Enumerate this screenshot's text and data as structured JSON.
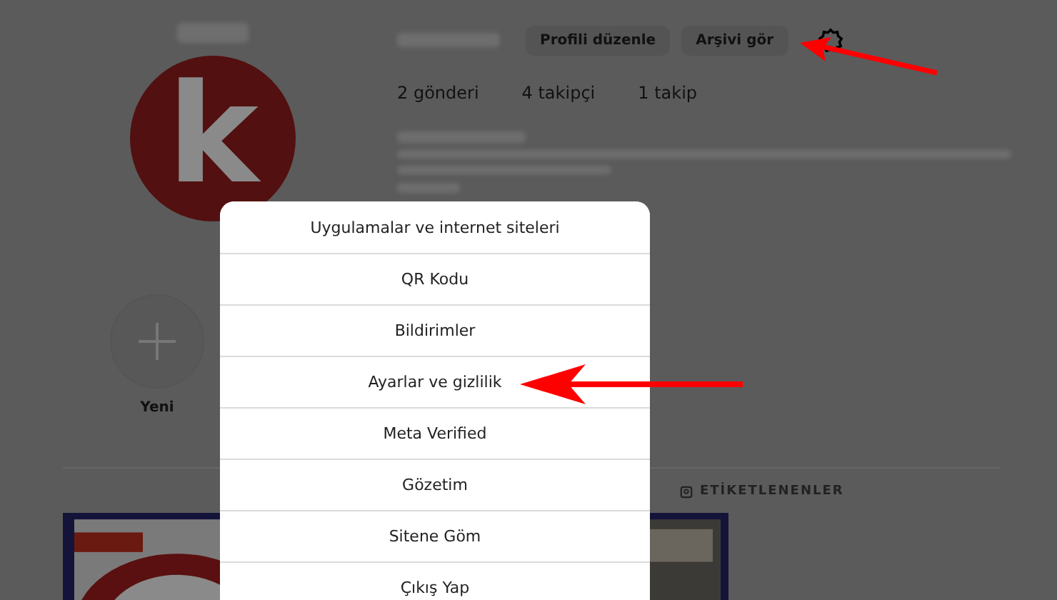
{
  "profile": {
    "avatar_letter": "k",
    "buttons": [
      "Profili düzenle",
      "Arşivi gör"
    ],
    "stats": [
      "2 gönderi",
      "4 takipçi",
      "1 takip"
    ]
  },
  "highlights": [
    {
      "label": "Yeni"
    }
  ],
  "tabs": [
    {
      "label": "ETİKETLENENLER"
    }
  ],
  "menu": {
    "items": [
      "Uygulamalar ve internet siteleri",
      "QR Kodu",
      "Bildirimler",
      "Ayarlar ve gizlilik",
      "Meta Verified",
      "Gözetim",
      "Sitene Göm",
      "Çıkış Yap"
    ]
  }
}
